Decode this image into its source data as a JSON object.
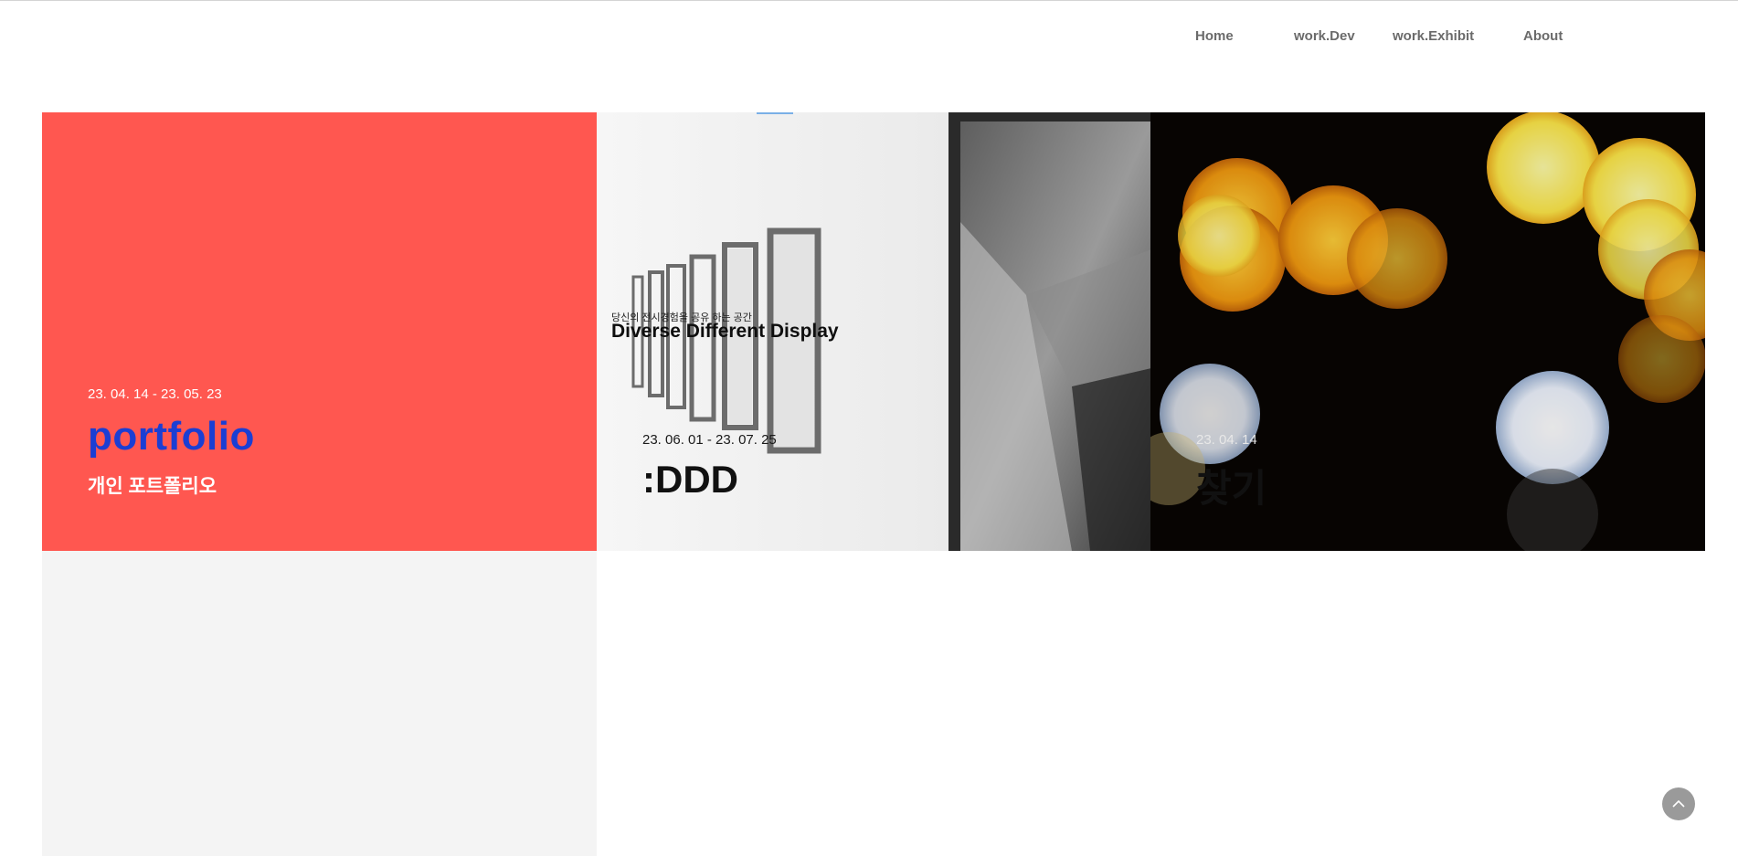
{
  "nav": {
    "items": [
      {
        "label": "Home"
      },
      {
        "label": "work.Dev"
      },
      {
        "label": "work.Exhibit"
      },
      {
        "label": "About"
      }
    ]
  },
  "cards": [
    {
      "date": "23. 04. 14 - 23. 05. 23",
      "title": "portfolio",
      "subtitle": "개인 포트폴리오",
      "background_color": "#ff5750",
      "title_color": "#1b3ed3"
    },
    {
      "caption": "당신의 전시경험을 공유 하는 공간",
      "headline": "Diverse Different Display",
      "date": "23. 06. 01 - 23. 07. 25",
      "title": ":DDD",
      "image": "gallery-frames-photo"
    },
    {
      "date": "23. 04. 14",
      "title": "찾기",
      "image": "bokeh-lights-photo"
    }
  ],
  "scroll_top": {
    "icon": "chevron-up-icon"
  }
}
